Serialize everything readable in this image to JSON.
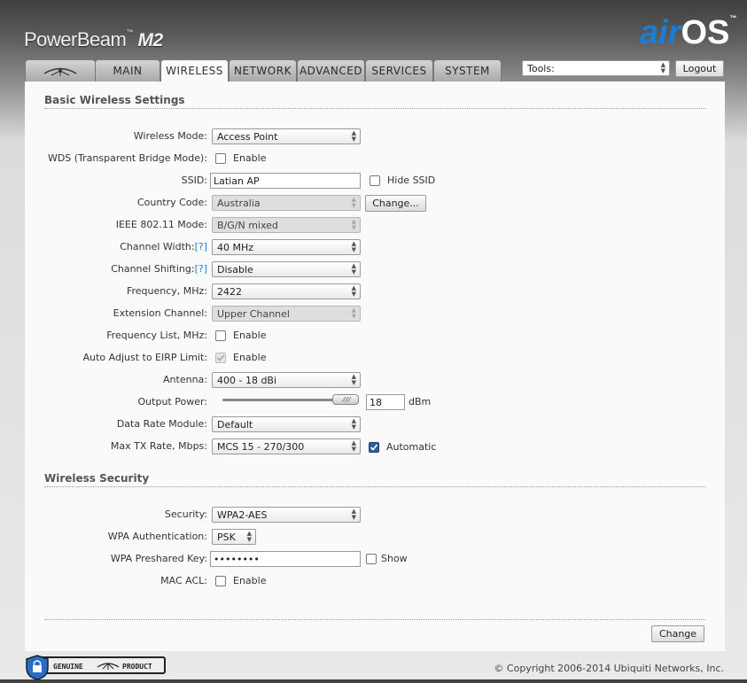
{
  "brand": {
    "name": "PowerBeam",
    "tm": "™",
    "model": "M2"
  },
  "logo": {
    "air": "air",
    "os": "OS",
    "tm": "™"
  },
  "tabs": [
    "",
    "MAIN",
    "WIRELESS",
    "NETWORK",
    "ADVANCED",
    "SERVICES",
    "SYSTEM"
  ],
  "active_tab": "WIRELESS",
  "tools": {
    "label": "Tools:"
  },
  "logout": "Logout",
  "basic": {
    "title": "Basic Wireless Settings",
    "wireless_mode": {
      "label": "Wireless Mode:",
      "value": "Access Point"
    },
    "wds": {
      "label": "WDS (Transparent Bridge Mode):",
      "cb": "Enable",
      "checked": false
    },
    "ssid": {
      "label": "SSID:",
      "value": "Latian AP",
      "hide": "Hide SSID",
      "checked": false
    },
    "country": {
      "label": "Country Code:",
      "value": "Australia",
      "button": "Change..."
    },
    "ieee": {
      "label": "IEEE 802.11 Mode:",
      "value": "B/G/N mixed"
    },
    "width": {
      "label": "Channel Width:",
      "help": "[?]",
      "value": "40 MHz"
    },
    "shift": {
      "label": "Channel Shifting:",
      "help": "[?]",
      "value": "Disable"
    },
    "freq": {
      "label": "Frequency, MHz:",
      "value": "2422"
    },
    "ext": {
      "label": "Extension Channel:",
      "value": "Upper Channel"
    },
    "freqlist": {
      "label": "Frequency List, MHz:",
      "cb": "Enable",
      "checked": false
    },
    "eirp": {
      "label": "Auto Adjust to EIRP Limit:",
      "cb": "Enable",
      "checked": true
    },
    "antenna": {
      "label": "Antenna:",
      "value": "400 - 18 dBi"
    },
    "power": {
      "label": "Output Power:",
      "value": "18",
      "unit": "dBm"
    },
    "drm": {
      "label": "Data Rate Module:",
      "value": "Default"
    },
    "maxtx": {
      "label": "Max TX Rate, Mbps:",
      "value": "MCS 15 - 270/300",
      "auto": "Automatic",
      "checked": true
    }
  },
  "security": {
    "title": "Wireless Security",
    "security": {
      "label": "Security:",
      "value": "WPA2-AES"
    },
    "auth": {
      "label": "WPA Authentication:",
      "value": "PSK"
    },
    "key": {
      "label": "WPA Preshared Key:",
      "value": "••••••••",
      "show": "Show",
      "checked": false
    },
    "acl": {
      "label": "MAC ACL:",
      "cb": "Enable",
      "checked": false
    }
  },
  "change_button": "Change",
  "footer": {
    "genuine": "GENUINE",
    "product": "PRODUCT",
    "copyright": "© Copyright 2006-2014 Ubiquiti Networks, Inc."
  }
}
